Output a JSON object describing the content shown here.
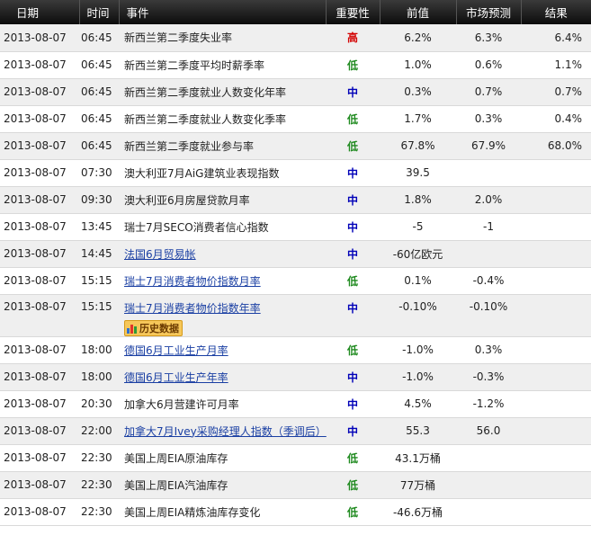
{
  "headers": {
    "date": "日期",
    "time": "时间",
    "event": "事件",
    "importance": "重要性",
    "previous": "前值",
    "forecast": "市场预测",
    "result": "结果"
  },
  "history_button_label": "历史数据",
  "rows": [
    {
      "date": "2013-08-07",
      "time": "06:45",
      "event": "新西兰第二季度失业率",
      "link": false,
      "importance": "高",
      "level": "high",
      "previous": "6.2%",
      "forecast": "6.3%",
      "result": "6.4%"
    },
    {
      "date": "2013-08-07",
      "time": "06:45",
      "event": "新西兰第二季度平均时薪季率",
      "link": false,
      "importance": "低",
      "level": "low",
      "previous": "1.0%",
      "forecast": "0.6%",
      "result": "1.1%"
    },
    {
      "date": "2013-08-07",
      "time": "06:45",
      "event": "新西兰第二季度就业人数变化年率",
      "link": false,
      "importance": "中",
      "level": "mid",
      "previous": "0.3%",
      "forecast": "0.7%",
      "result": "0.7%"
    },
    {
      "date": "2013-08-07",
      "time": "06:45",
      "event": "新西兰第二季度就业人数变化季率",
      "link": false,
      "importance": "低",
      "level": "low",
      "previous": "1.7%",
      "forecast": "0.3%",
      "result": "0.4%"
    },
    {
      "date": "2013-08-07",
      "time": "06:45",
      "event": "新西兰第二季度就业参与率",
      "link": false,
      "importance": "低",
      "level": "low",
      "previous": "67.8%",
      "forecast": "67.9%",
      "result": "68.0%"
    },
    {
      "date": "2013-08-07",
      "time": "07:30",
      "event": "澳大利亚7月AiG建筑业表现指数",
      "link": false,
      "importance": "中",
      "level": "mid",
      "previous": "39.5",
      "forecast": "",
      "result": ""
    },
    {
      "date": "2013-08-07",
      "time": "09:30",
      "event": "澳大利亚6月房屋贷款月率",
      "link": false,
      "importance": "中",
      "level": "mid",
      "previous": "1.8%",
      "forecast": "2.0%",
      "result": ""
    },
    {
      "date": "2013-08-07",
      "time": "13:45",
      "event": "瑞士7月SECO消费者信心指数",
      "link": false,
      "importance": "中",
      "level": "mid",
      "previous": "-5",
      "forecast": "-1",
      "result": ""
    },
    {
      "date": "2013-08-07",
      "time": "14:45",
      "event": "法国6月贸易帐",
      "link": true,
      "importance": "中",
      "level": "mid",
      "previous": "-60亿欧元",
      "forecast": "",
      "result": ""
    },
    {
      "date": "2013-08-07",
      "time": "15:15",
      "event": "瑞士7月消费者物价指数月率",
      "link": true,
      "importance": "低",
      "level": "low",
      "previous": "0.1%",
      "forecast": "-0.4%",
      "result": ""
    },
    {
      "date": "2013-08-07",
      "time": "15:15",
      "event": "瑞士7月消费者物价指数年率",
      "link": true,
      "importance": "中",
      "level": "mid",
      "previous": "-0.10%",
      "forecast": "-0.10%",
      "result": "",
      "history": true
    },
    {
      "date": "2013-08-07",
      "time": "18:00",
      "event": "德国6月工业生产月率",
      "link": true,
      "importance": "低",
      "level": "low",
      "previous": "-1.0%",
      "forecast": "0.3%",
      "result": ""
    },
    {
      "date": "2013-08-07",
      "time": "18:00",
      "event": "德国6月工业生产年率",
      "link": true,
      "importance": "中",
      "level": "mid",
      "previous": "-1.0%",
      "forecast": "-0.3%",
      "result": ""
    },
    {
      "date": "2013-08-07",
      "time": "20:30",
      "event": "加拿大6月营建许可月率",
      "link": false,
      "importance": "中",
      "level": "mid",
      "previous": "4.5%",
      "forecast": "-1.2%",
      "result": ""
    },
    {
      "date": "2013-08-07",
      "time": "22:00",
      "event": "加拿大7月Ivey采购经理人指数（季调后）",
      "link": true,
      "importance": "中",
      "level": "mid",
      "previous": "55.3",
      "forecast": "56.0",
      "result": ""
    },
    {
      "date": "2013-08-07",
      "time": "22:30",
      "event": "美国上周EIA原油库存",
      "link": false,
      "importance": "低",
      "level": "low",
      "previous": "43.1万桶",
      "forecast": "",
      "result": ""
    },
    {
      "date": "2013-08-07",
      "time": "22:30",
      "event": "美国上周EIA汽油库存",
      "link": false,
      "importance": "低",
      "level": "low",
      "previous": "77万桶",
      "forecast": "",
      "result": ""
    },
    {
      "date": "2013-08-07",
      "time": "22:30",
      "event": "美国上周EIA精炼油库存变化",
      "link": false,
      "importance": "低",
      "level": "low",
      "previous": "-46.6万桶",
      "forecast": "",
      "result": ""
    }
  ]
}
